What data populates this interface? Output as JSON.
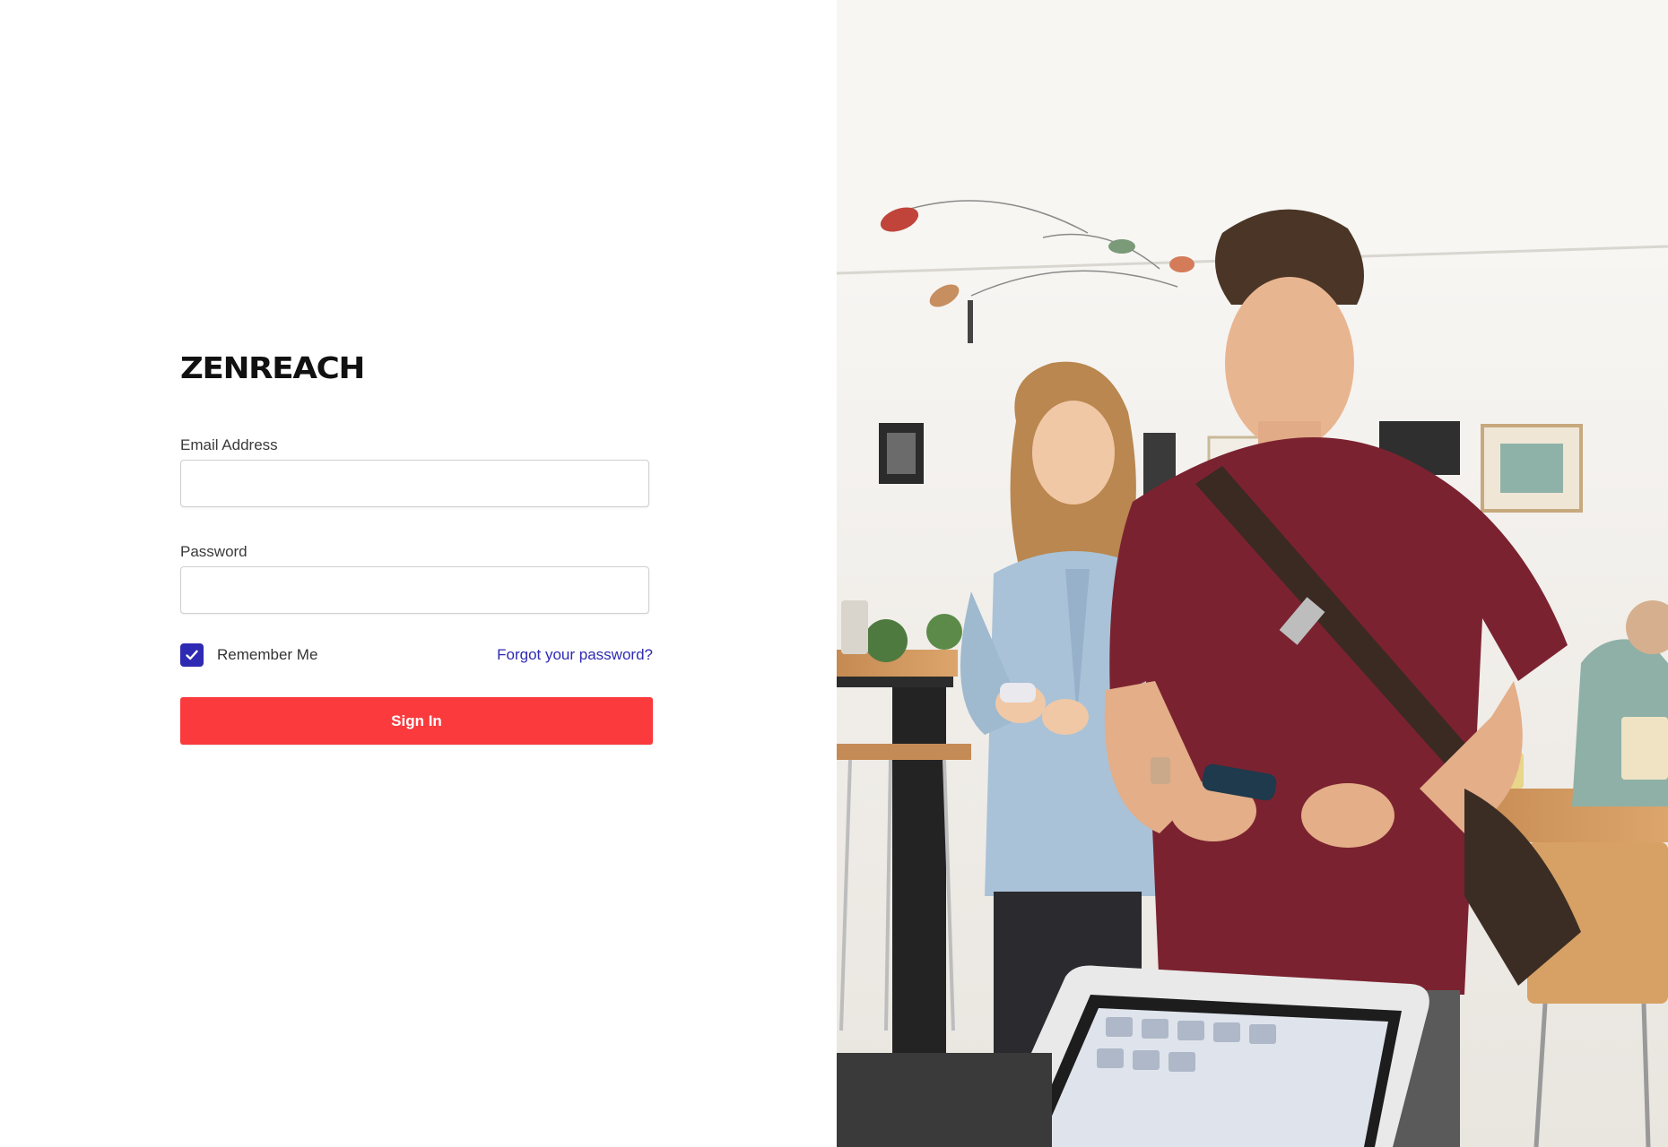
{
  "brand": {
    "logo_text": "ZENREACH"
  },
  "form": {
    "email_label": "Email Address",
    "email_value": "",
    "password_label": "Password",
    "password_value": "",
    "remember_label": "Remember Me",
    "remember_checked": true,
    "forgot_label": "Forgot your password?",
    "signin_label": "Sign In"
  },
  "colors": {
    "accent": "#2f2ab3",
    "primary_button": "#fb3a3d",
    "logo": "#111111"
  },
  "hero_image": {
    "kind": "photo"
  }
}
